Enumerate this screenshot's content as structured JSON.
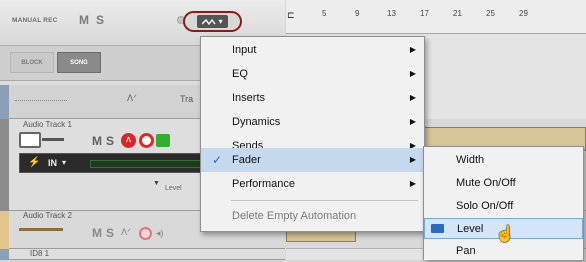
{
  "toolbar": {
    "manual_rec": "MANUAL REC",
    "m_label": "M",
    "s_label": "S",
    "block_label": "BLOCK",
    "song_label": "SONG",
    "automation_button_caret": "▾"
  },
  "ruler": {
    "ticks": [
      "5",
      "9",
      "13",
      "17",
      "21",
      "25",
      "29"
    ]
  },
  "ruler_strip": {
    "tr_label": "Tra"
  },
  "tracks": [
    {
      "name": "Audio Track 1",
      "m": "M",
      "s": "S",
      "input": "IN",
      "level_label": "Level"
    },
    {
      "name": "Audio Track 2",
      "m": "M",
      "s": "S"
    },
    {
      "name": "ID8 1"
    }
  ],
  "menu": {
    "items": [
      {
        "label": "Input",
        "has_submenu": true
      },
      {
        "label": "EQ",
        "has_submenu": true
      },
      {
        "label": "Inserts",
        "has_submenu": true
      },
      {
        "label": "Dynamics",
        "has_submenu": true
      },
      {
        "label": "Sends",
        "has_submenu": true
      },
      {
        "label": "Fader",
        "has_submenu": true,
        "checked": true
      },
      {
        "label": "Performance",
        "has_submenu": true
      },
      {
        "label": "Delete Empty Automation",
        "disabled": true
      }
    ],
    "check_glyph": "✓",
    "arrow_glyph": "▶"
  },
  "submenu": {
    "items": [
      {
        "label": "Width"
      },
      {
        "label": "Mute On/Off"
      },
      {
        "label": "Solo On/Off"
      },
      {
        "label": "Level",
        "selected": true
      },
      {
        "label": "Pan"
      }
    ]
  },
  "colors": {
    "track1_stripe": "#8c8c8c",
    "track2_stripe": "#e2c48d",
    "rec_red": "#d9262c",
    "speaker_green": "#2fae2f",
    "highlight": "#7aa8dd"
  }
}
